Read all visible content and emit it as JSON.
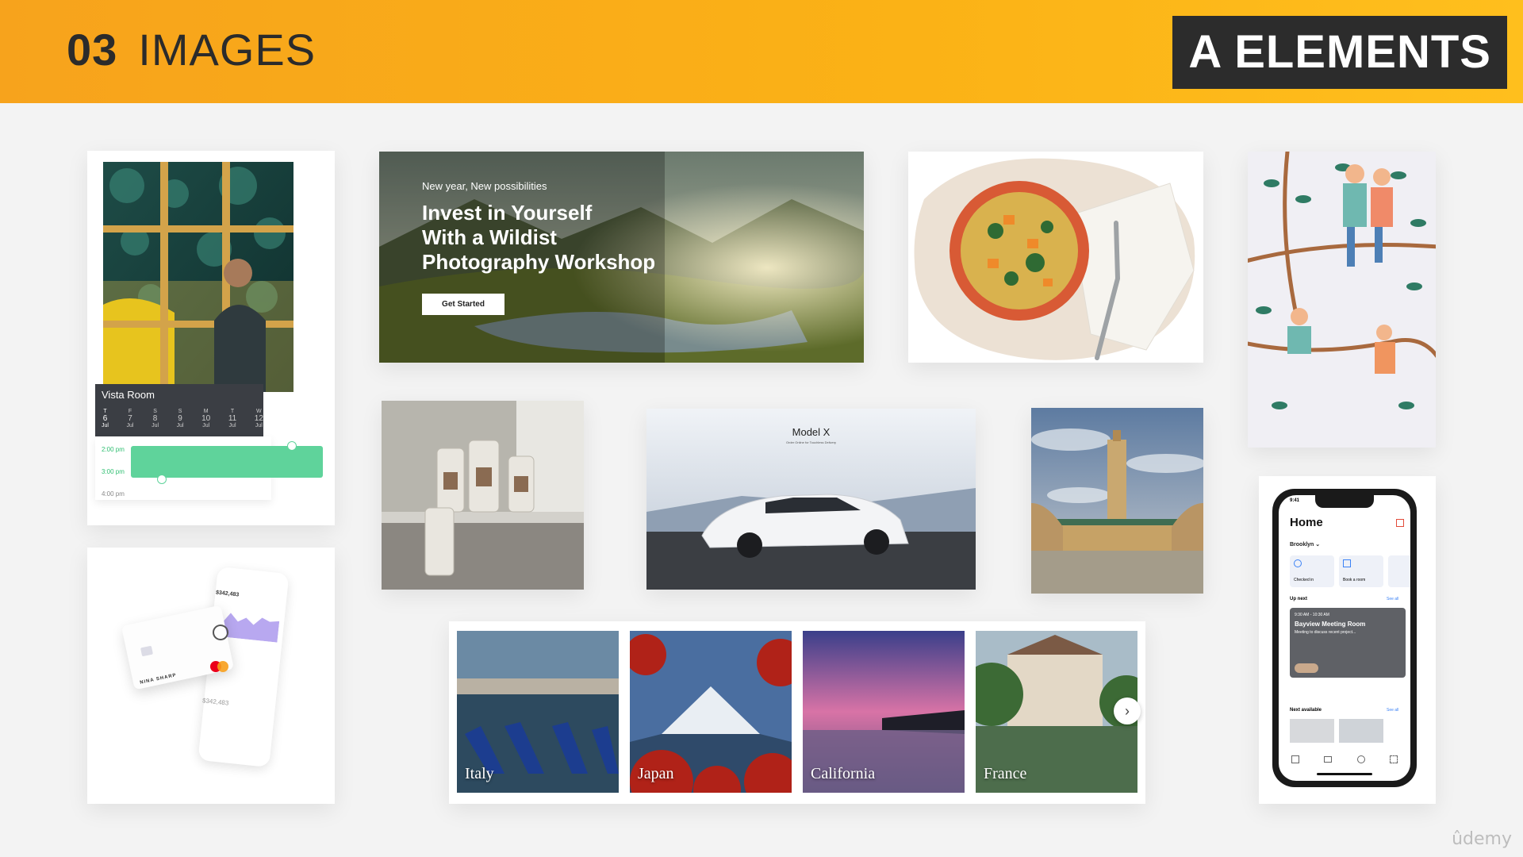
{
  "header": {
    "number": "03",
    "title": "IMAGES",
    "badge": "A ELEMENTS"
  },
  "booking_card": {
    "room": "Vista Room",
    "days": [
      {
        "dow": "T",
        "num": "6",
        "mon": "Jul"
      },
      {
        "dow": "F",
        "num": "7",
        "mon": "Jul"
      },
      {
        "dow": "S",
        "num": "8",
        "mon": "Jul"
      },
      {
        "dow": "S",
        "num": "9",
        "mon": "Jul"
      },
      {
        "dow": "M",
        "num": "10",
        "mon": "Jul"
      },
      {
        "dow": "T",
        "num": "11",
        "mon": "Jul"
      },
      {
        "dow": "W",
        "num": "12",
        "mon": "Jul"
      }
    ],
    "times": [
      "2:00 pm",
      "3:00 pm",
      "4:00 pm"
    ]
  },
  "hero": {
    "eyebrow": "New year, New possibilities",
    "headline_1": "Invest in Yourself",
    "headline_2": "With a Wildist",
    "headline_3": "Photography Workshop",
    "cta": "Get Started"
  },
  "car": {
    "title": "Model X",
    "subtitle": "Order Online for Touchless Delivery"
  },
  "card_app": {
    "name": "NINA SHARP",
    "balance": "$342,483",
    "mini_balance": "$342,483"
  },
  "destinations": [
    "Italy",
    "Japan",
    "California",
    "France"
  ],
  "phone": {
    "time": "9:41",
    "title": "Home",
    "location": "Brooklyn",
    "tiles": [
      "Checked in",
      "Book a room"
    ],
    "up_next": "Up next",
    "see_all_1": "See all",
    "meeting_time": "9:30 AM - 10:30 AM",
    "meeting_title": "Bayview Meeting Room",
    "meeting_desc": "Meeting to discuss recent project...",
    "next_available": "Next available",
    "see_all_2": "See all"
  },
  "watermark": "ûdemy"
}
